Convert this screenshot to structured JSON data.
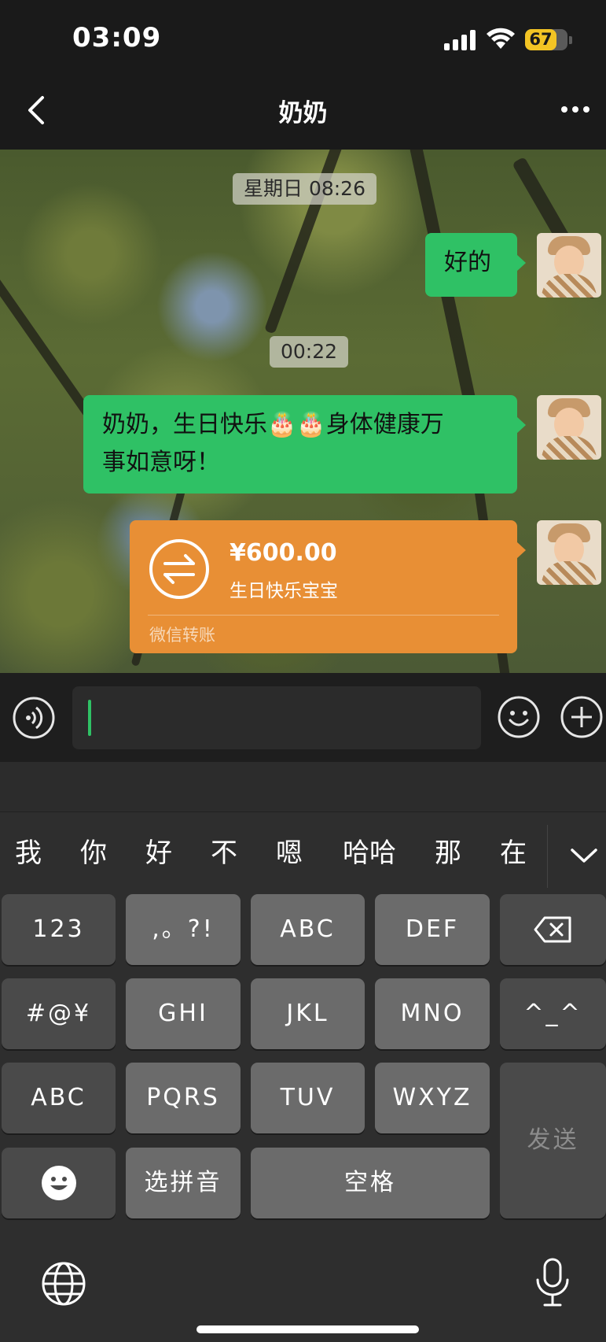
{
  "status_bar": {
    "time": "03:09",
    "battery_level": "67",
    "battery_color": "#f3c424"
  },
  "nav": {
    "title": "奶奶",
    "back_icon": "chevron-left-icon",
    "more_icon": "more-dots-icon"
  },
  "chat": {
    "timestamps": [
      "星期日 08:26",
      "00:22"
    ],
    "messages": [
      {
        "text": "好的",
        "sender": "me"
      },
      {
        "text_line1": "奶奶，生日快乐🎂🎂身体健康万",
        "text_line2": "事如意呀！",
        "sender": "me"
      }
    ],
    "transfer": {
      "amount": "¥600.00",
      "note": "生日快乐宝宝",
      "label": "微信转账",
      "icon": "transfer-arrows-icon"
    }
  },
  "input_bar": {
    "value": "",
    "voice_icon": "voice-icon",
    "emoji_icon": "emoji-icon",
    "plus_icon": "plus-icon"
  },
  "keyboard": {
    "candidates": [
      "我",
      "你",
      "好",
      "不",
      "嗯",
      "哈哈",
      "那",
      "在"
    ],
    "collapse_icon": "chevron-down-icon",
    "keys": {
      "k123": "123",
      "punct": ",。?!",
      "abc_t9": "ABC",
      "def": "DEF",
      "symbols": "#@¥",
      "ghi": "GHI",
      "jkl": "JKL",
      "mno": "MNO",
      "emoticon": "^_^",
      "abc_mode": "ABC",
      "pqrs": "PQRS",
      "tuv": "TUV",
      "wxyz": "WXYZ",
      "send": "发送",
      "pinyin": "选拼音",
      "space": "空格"
    },
    "backspace_icon": "backspace-icon",
    "emoji_key_icon": "emoji-icon",
    "globe_icon": "globe-icon",
    "mic_icon": "microphone-icon"
  },
  "colors": {
    "bubble_green": "#2fc165",
    "transfer_orange": "#e88f35"
  }
}
